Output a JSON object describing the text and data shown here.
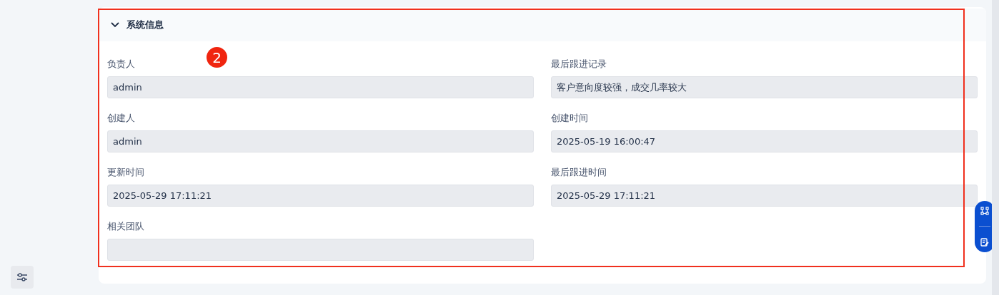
{
  "section": {
    "title": "系统信息",
    "expanded": true
  },
  "fields": [
    {
      "label": "负责人",
      "value": "admin"
    },
    {
      "label": "最后跟进记录",
      "value": "客户意向度较强，成交几率较大"
    },
    {
      "label": "创建人",
      "value": "admin"
    },
    {
      "label": "创建时间",
      "value": "2025-05-19 16:00:47"
    },
    {
      "label": "更新时间",
      "value": "2025-05-29 17:11:21"
    },
    {
      "label": "最后跟进时间",
      "value": "2025-05-29 17:11:21"
    },
    {
      "label": "相关团队"
    }
  ],
  "annotation": {
    "badge": "2"
  }
}
